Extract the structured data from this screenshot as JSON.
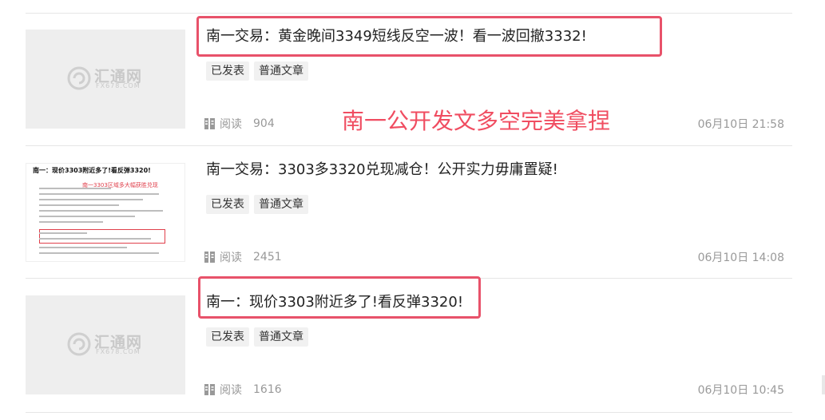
{
  "articles": [
    {
      "title": "南一交易：黄金晚间3349短线反空一波！看一波回撤3332!",
      "tags": [
        "已发表",
        "普通文章"
      ],
      "read_label": "阅读",
      "read_count": "904",
      "date": "06月10日 21:58",
      "thumbnail": "placeholder"
    },
    {
      "title": "南一交易：3303多3320兑现减仓！公开实力毋庸置疑!",
      "tags": [
        "已发表",
        "普通文章"
      ],
      "read_label": "阅读",
      "read_count": "2451",
      "date": "06月10日 14:08",
      "thumbnail": "article-preview"
    },
    {
      "title": "南一：现价3303附近多了!看反弹3320!",
      "tags": [
        "已发表",
        "普通文章"
      ],
      "read_label": "阅读",
      "read_count": "1616",
      "date": "06月10日 10:45",
      "thumbnail": "placeholder"
    }
  ],
  "watermark": {
    "text": "汇通网",
    "sub": "FX678.COM"
  },
  "annotation": "南一公开发文多空完美拿捏",
  "mini_preview": {
    "title": "南一：现价3303附近多了!看反弹3320!",
    "red_note": "南一3303区域多大幅获胜兑现"
  },
  "colors": {
    "highlight": "#e8526a",
    "annotation": "#f04d61",
    "tag_bg": "#f1f1f1"
  },
  "icons": {
    "read": "book-icon",
    "watermark": "fx678-logo"
  }
}
